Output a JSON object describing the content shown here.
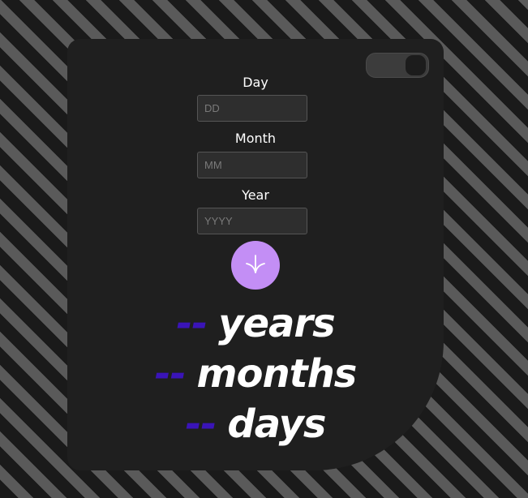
{
  "theme_toggle": {
    "state": "on"
  },
  "form": {
    "day": {
      "label": "Day",
      "placeholder": "DD",
      "value": ""
    },
    "month": {
      "label": "Month",
      "placeholder": "MM",
      "value": ""
    },
    "year": {
      "label": "Year",
      "placeholder": "YYYY",
      "value": ""
    },
    "submit_icon": "arrow-down-icon"
  },
  "results": [
    {
      "value": "--",
      "unit": "years"
    },
    {
      "value": "--",
      "unit": "months"
    },
    {
      "value": "--",
      "unit": "days"
    }
  ],
  "colors": {
    "card_background": "#1f1f1f",
    "accent_button": "#c38ef5",
    "result_value": "#3a14b8",
    "result_text": "#ffffff"
  }
}
